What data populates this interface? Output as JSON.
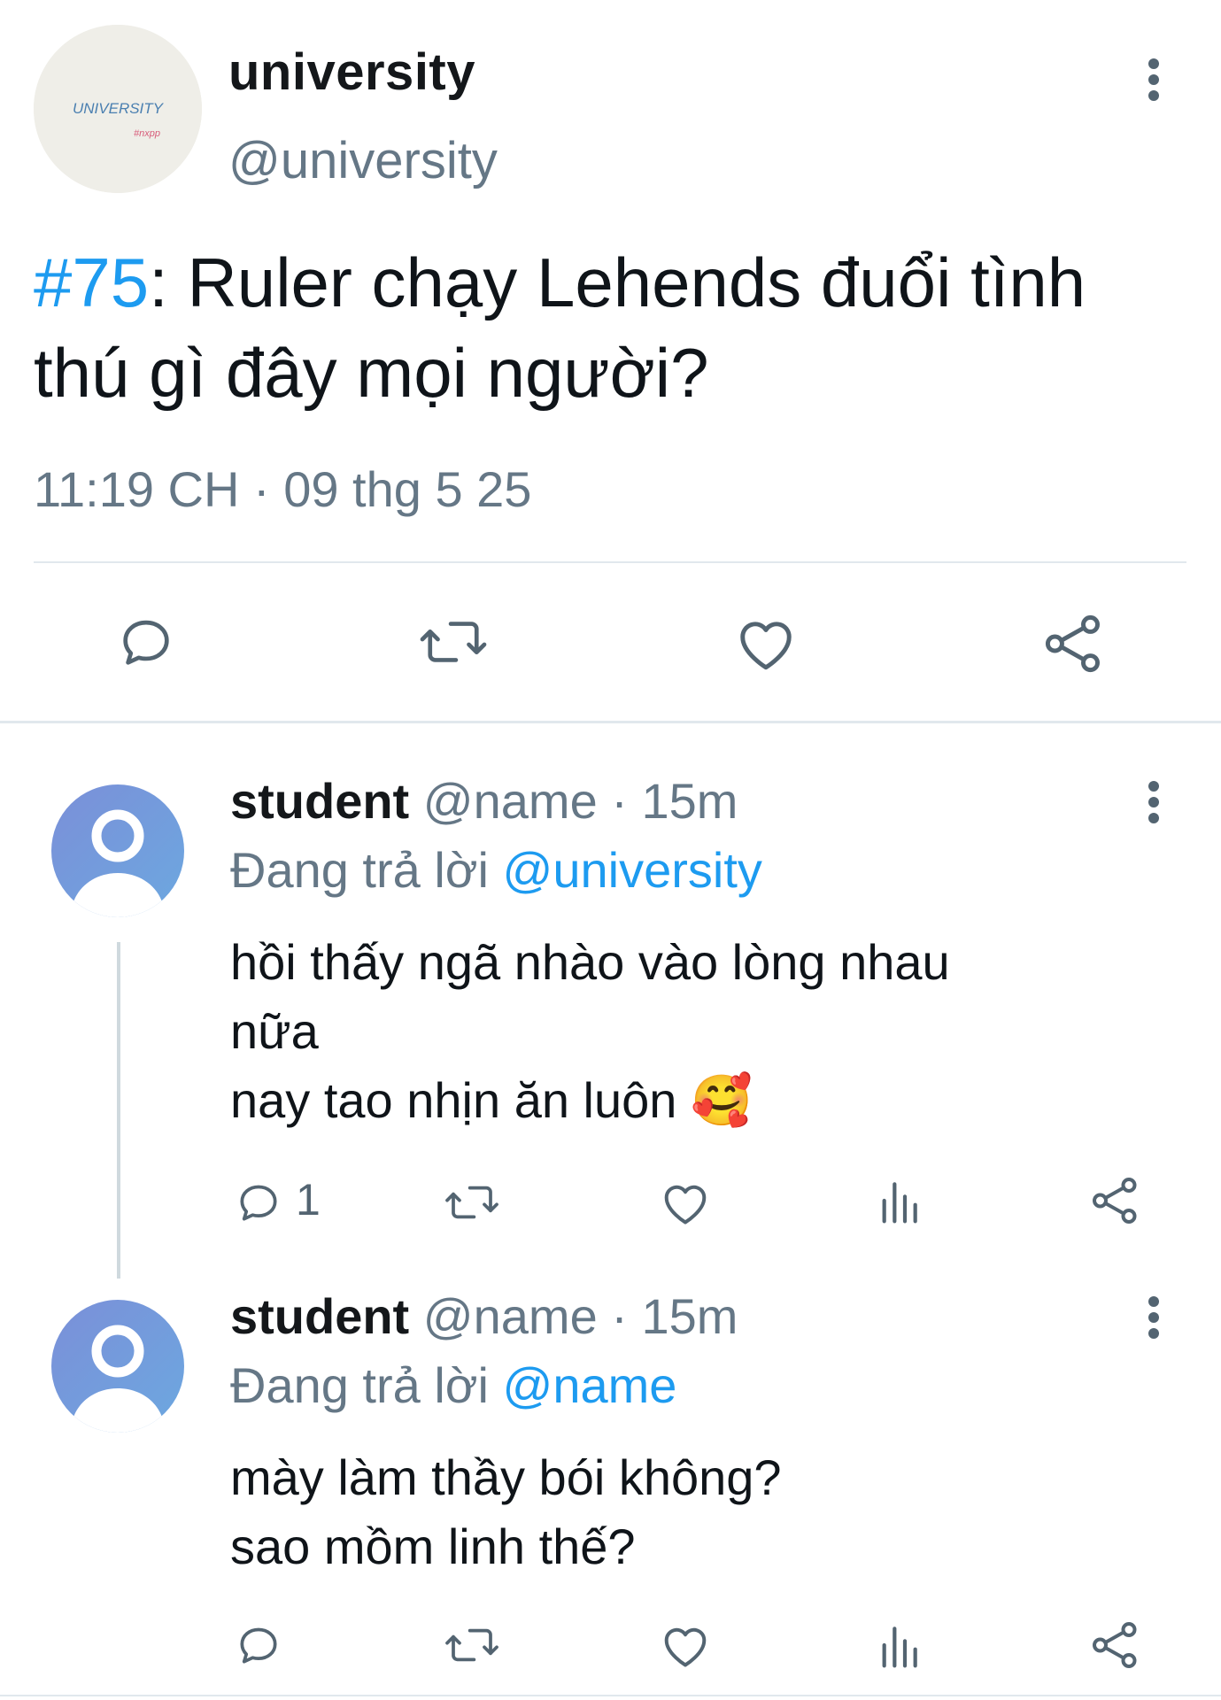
{
  "tweet": {
    "avatar_text": "UNIVERSITY",
    "avatar_subtext": "#nxpp",
    "name": "university",
    "handle": "@university",
    "hashtag": "#75",
    "text": ": Ruler chạy Lehends đuổi tình thú gì đây mọi người?",
    "timestamp": "11:19 CH · 09 thg 5 25",
    "actions": [
      {
        "name": "reply",
        "icon": "speech-bubble-icon"
      },
      {
        "name": "retweet",
        "icon": "retweet-icon"
      },
      {
        "name": "like",
        "icon": "heart-icon"
      },
      {
        "name": "share",
        "icon": "share-icon"
      }
    ]
  },
  "replies": [
    {
      "name": "student",
      "handle_time": "@name · 15m",
      "replying_label": "Đang trả lời",
      "replying_to": "@university",
      "lines": [
        "hồi thấy ngã nhào vào lòng nhau",
        "nữa",
        "nay tao nhịn ăn luôn 🥰"
      ],
      "reply_count": "1"
    },
    {
      "name": "student",
      "handle_time": "@name · 15m",
      "replying_label": "Đang trả lời",
      "replying_to": "@name",
      "lines": [
        "mày làm thầy bói không?",
        "sao mồm linh thế?"
      ],
      "reply_count": ""
    }
  ],
  "colors": {
    "accent": "#1d9bf0",
    "secondary_text": "#657786",
    "icon": "#536471",
    "divider": "#e1e8ed"
  }
}
